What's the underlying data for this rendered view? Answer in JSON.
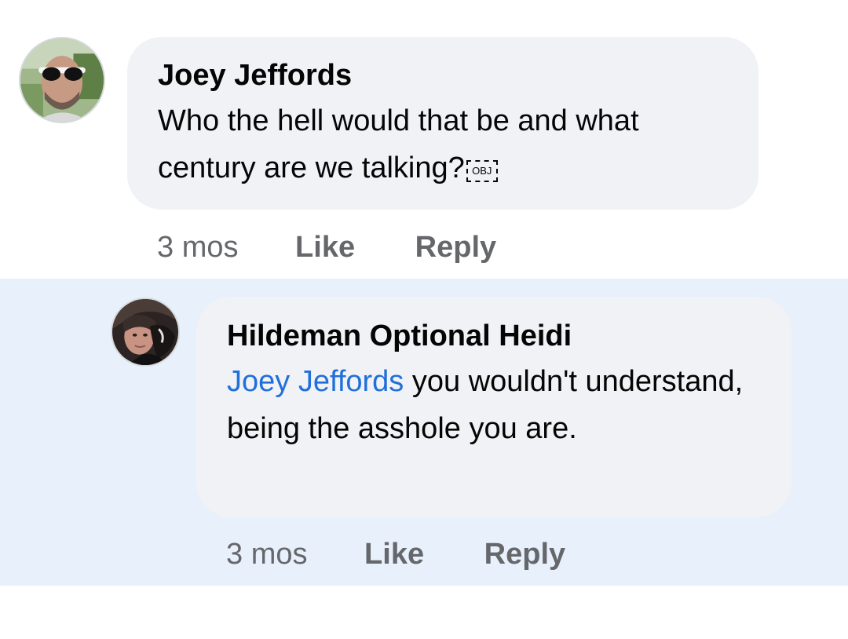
{
  "comments": [
    {
      "author": "Joey Jeffords",
      "text": "Who the hell would that be and what century are we talking?",
      "obj_placeholder": "OBJ",
      "time": "3 mos",
      "like_label": "Like",
      "reply_label": "Reply",
      "avatar_icon": "profile-photo-sunglasses"
    },
    {
      "author": "Hildeman Optional Heidi",
      "mention": "Joey Jeffords",
      "text": " you wouldn't understand, being the asshole you are.",
      "time": "3 mos",
      "like_label": "Like",
      "reply_label": "Reply",
      "avatar_icon": "profile-photo-woman"
    }
  ],
  "colors": {
    "bubble_bg": "#f0f2f5",
    "highlight_bg": "#e7f0fb",
    "mention": "#216fdb",
    "meta_text": "#65676b"
  }
}
